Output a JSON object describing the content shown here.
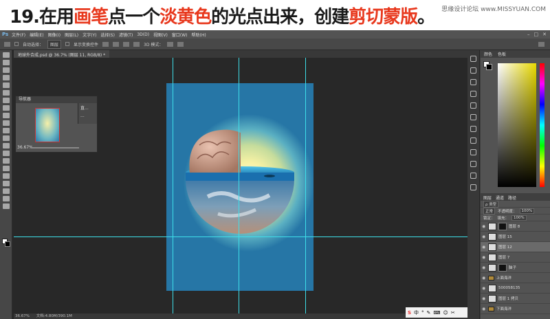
{
  "banner": {
    "prefix": "19.在用",
    "hl1": "画笔",
    "mid1": "点一个",
    "hl2": "淡黄色",
    "mid2": "的光点出来，创建",
    "hl3": "剪切蒙版",
    "suffix": "。",
    "watermark": "思缘设计论坛 www.MISSYUAN.COM"
  },
  "menubar": {
    "logo": "Ps",
    "items": [
      "文件(F)",
      "编辑(E)",
      "图像(I)",
      "图层(L)",
      "文字(Y)",
      "选择(S)",
      "滤镜(T)",
      "3D(D)",
      "视图(V)",
      "窗口(W)",
      "帮助(H)"
    ],
    "window_controls": [
      "–",
      "□",
      "✕"
    ]
  },
  "options": {
    "auto_select": "自动选择：",
    "layer_select": "图层",
    "show_transform": "显示变换控件",
    "mode_3d": "3D 模式："
  },
  "document": {
    "tab_label": "地球外合成.psd @ 36.7% (图层 11, RGB/8) *"
  },
  "navigator": {
    "title": "导航器",
    "zoom": "36.67%",
    "side_items": [
      "直...",
      "..."
    ]
  },
  "colors": {
    "tabs": [
      "颜色",
      "色板"
    ]
  },
  "layers": {
    "tabs": [
      "图层",
      "通道",
      "路径"
    ],
    "filter_label": "ρ 类型",
    "blend_mode": "正常",
    "opacity_label": "不透明度：",
    "opacity": "100%",
    "lock_label": "锁定：",
    "fill_label": "填充：",
    "fill": "100%",
    "items": [
      {
        "name": "图层 8",
        "type": "layer"
      },
      {
        "name": "图层 15",
        "type": "layer"
      },
      {
        "name": "图层 12",
        "type": "layer"
      },
      {
        "name": "图层 7",
        "type": "layer"
      },
      {
        "name": "脑子",
        "type": "layer"
      },
      {
        "name": "上面海洋",
        "type": "group"
      },
      {
        "name": "500058135",
        "type": "layer"
      },
      {
        "name": "图层 1 拷贝",
        "type": "layer"
      },
      {
        "name": "下面海洋",
        "type": "group"
      }
    ]
  },
  "status": {
    "zoom": "36.67%",
    "doc": "文档:4.80M/390.1M"
  },
  "taskbar": {
    "ime": "S",
    "items": [
      "中",
      "°",
      "✎",
      "⌨",
      "☺",
      "✂"
    ]
  }
}
